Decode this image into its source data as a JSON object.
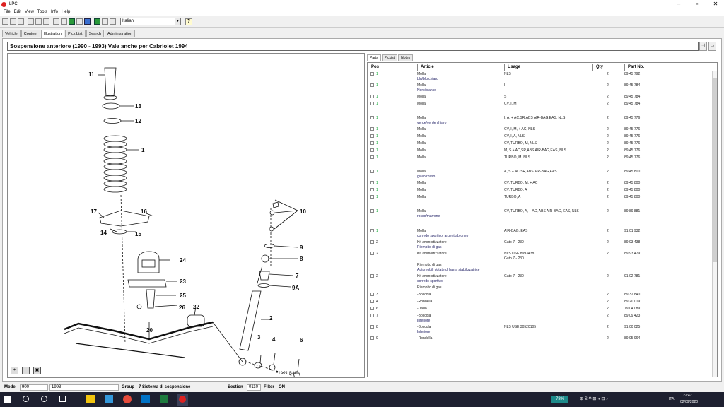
{
  "window": {
    "title": "LPC"
  },
  "menu": [
    "File",
    "Edit",
    "View",
    "Tools",
    "Info",
    "Help"
  ],
  "toolbar": {
    "language": "Italian",
    "help_label": "?"
  },
  "tabs": [
    "Vehicle",
    "Content",
    "Illustration",
    "Pick List",
    "Search",
    "Administration"
  ],
  "header": {
    "title": "Sospensione anteriore   (1990 - 1993)   Vale anche per Cabriolet 1994"
  },
  "illustration": {
    "callouts": [
      "11",
      "13",
      "12",
      "1",
      "10",
      "9",
      "8",
      "7",
      "9A",
      "17",
      "16",
      "14",
      "15",
      "24",
      "23",
      "25",
      "26",
      "22",
      "20",
      "2",
      "3",
      "4",
      "6"
    ],
    "code": "F1A21 BAE",
    "zoom_in_label": "+",
    "zoom_out_label": "-",
    "fit_label": "▣"
  },
  "parts_tabs": [
    "Parts",
    "Pickist",
    "Notes"
  ],
  "parts_header": {
    "pos": "Pos",
    "article": "Article",
    "usage": "Usage",
    "qty": "Qty",
    "part_no": "Part No."
  },
  "parts": [
    {
      "pos": "1",
      "article": "Molla",
      "sub": "blu/blu chiaro",
      "usage": "NLS",
      "usage2": "",
      "qty": "2",
      "part_no": "89 45 792"
    },
    {
      "pos": "1",
      "article": "Molla",
      "sub": "Nero/bianco",
      "usage": "I",
      "usage2": "",
      "qty": "2",
      "part_no": "89 45 784"
    },
    {
      "pos": "1",
      "article": "Molla",
      "sub": "",
      "usage": "S",
      "usage2": "",
      "qty": "2",
      "part_no": "89 45 784"
    },
    {
      "pos": "1",
      "article": "Molla",
      "sub": "",
      "usage": "CV, I, M",
      "usage2": "",
      "qty": "2",
      "part_no": "89 45 784"
    },
    {
      "pos": "1",
      "article": "Molla",
      "sub": "verde/verde chiaro",
      "usage": "I, A, + AC,SR,ABS AIR-BAG,EAS, NLS",
      "usage2": "",
      "qty": "2",
      "part_no": "89 45 776"
    },
    {
      "pos": "1",
      "article": "Molla",
      "sub": "",
      "usage": "CV, I, M, + AC, NLS",
      "usage2": "",
      "qty": "2",
      "part_no": "89 45 776"
    },
    {
      "pos": "1",
      "article": "Molla",
      "sub": "",
      "usage": "CV, I, A, NLS",
      "usage2": "",
      "qty": "2",
      "part_no": "89 45 776"
    },
    {
      "pos": "1",
      "article": "Molla",
      "sub": "",
      "usage": "CV, TURBO, M, NLS",
      "usage2": "",
      "qty": "2",
      "part_no": "89 45 776"
    },
    {
      "pos": "1",
      "article": "Molla",
      "sub": "",
      "usage": "M, S + AC,SR,ABS AIR-BAG,EAS, NLS",
      "usage2": "",
      "qty": "2",
      "part_no": "89 45 776"
    },
    {
      "pos": "1",
      "article": "Molla",
      "sub": "",
      "usage": "TURBO, M, NLS",
      "usage2": "",
      "qty": "2",
      "part_no": "89 45 776"
    },
    {
      "pos": "1",
      "article": "Molla",
      "sub": "giallo/rosso",
      "usage": "A, S + AC,SR,ABS AIR-BAG,EAS",
      "usage2": "",
      "qty": "2",
      "part_no": "89 45 800"
    },
    {
      "pos": "1",
      "article": "Molla",
      "sub": "",
      "usage": "CV, TURBO, M, + AC",
      "usage2": "",
      "qty": "2",
      "part_no": "89 45 800"
    },
    {
      "pos": "1",
      "article": "Molla",
      "sub": "",
      "usage": "CV, TURBO, A",
      "usage2": "",
      "qty": "2",
      "part_no": "89 45 800"
    },
    {
      "pos": "1",
      "article": "Molla",
      "sub": "",
      "usage": "TURBO, A",
      "usage2": "",
      "qty": "2",
      "part_no": "89 45 800"
    },
    {
      "pos": "1",
      "article": "Molla",
      "sub": "rosso/marrone",
      "usage": "CV, TURBO, A, + AC, ABS AIR-BAG, EAS, NLS",
      "usage2": "",
      "qty": "2",
      "part_no": "89 89 881"
    },
    {
      "pos": "1",
      "article": "Molla",
      "sub": "corredo sportivo, argento/bronzo",
      "usage": "AIR-BAG, EAS",
      "usage2": "",
      "qty": "2",
      "part_no": "91 01 932"
    },
    {
      "pos": "2",
      "article": "Kit ammortizzatore",
      "sub": "Riempito di gas",
      "usage": "Gato 7 - 230",
      "usage2": "",
      "qty": "2",
      "part_no": "89 93 438"
    },
    {
      "pos": "2",
      "article": "Kit ammortizzatore",
      "sub": "",
      "usage": "NLS USE 8993438",
      "usage2": "Gato 7 - 230",
      "qty": "2",
      "part_no": "89 93 479"
    },
    {
      "pos": "",
      "article": "Riempito di gas",
      "sub": "Automobili dotate di barra stabilizzatrice",
      "usage": "",
      "usage2": "",
      "qty": "",
      "part_no": ""
    },
    {
      "pos": "2",
      "article": "Kit ammortizzatore",
      "sub": "corredo sportivo",
      "usage": "Gato 7 - 230",
      "usage2": "",
      "qty": "2",
      "part_no": "91 02 781"
    },
    {
      "pos": "",
      "article": "Riempito di gas",
      "sub": "",
      "usage": "",
      "usage2": "",
      "qty": "",
      "part_no": ""
    },
    {
      "pos": "3",
      "article": "-Boccola",
      "sub": "",
      "usage": "",
      "usage2": "",
      "qty": "2",
      "part_no": "89 32 840"
    },
    {
      "pos": "4",
      "article": "-Rondella",
      "sub": "",
      "usage": "",
      "usage2": "",
      "qty": "2",
      "part_no": "89 20 019"
    },
    {
      "pos": "6",
      "article": "-Dado",
      "sub": "",
      "usage": "",
      "usage2": "",
      "qty": "2",
      "part_no": "79 04 089"
    },
    {
      "pos": "7",
      "article": "-Boccola",
      "sub": "Inferiore",
      "usage": "",
      "usage2": "",
      "qty": "2",
      "part_no": "89 09 423"
    },
    {
      "pos": "8",
      "article": "-Boccola",
      "sub": "Inferiore",
      "usage": "NLS USE 30520105",
      "usage2": "",
      "qty": "2",
      "part_no": "91 00 025"
    },
    {
      "pos": "9",
      "article": "-Rondella",
      "sub": "",
      "usage": "",
      "usage2": "",
      "qty": "2",
      "part_no": "89 95 964"
    }
  ],
  "status": {
    "model_label": "Model",
    "model": "900",
    "year": "1993",
    "group_label": "Group",
    "group": "7 Sistema di sospensione",
    "section_label": "Section",
    "section": "0110",
    "filter_label": "Filter",
    "filter": "ON"
  },
  "taskbar": {
    "battery": "78%",
    "time": "22:42",
    "date": "02/09/2020",
    "lang": "ITA"
  }
}
